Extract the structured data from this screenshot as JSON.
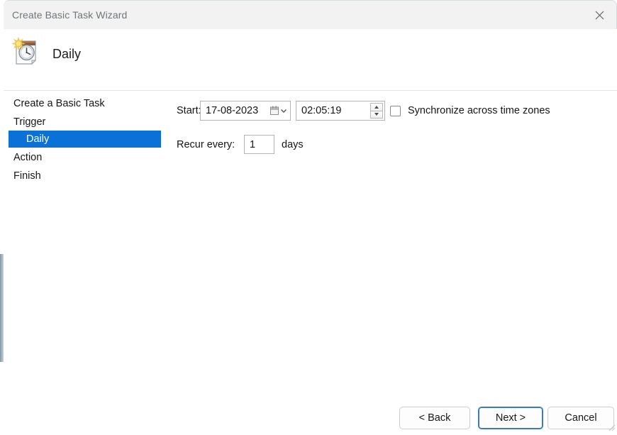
{
  "window": {
    "title": "Create Basic Task Wizard",
    "close_icon": "close-icon"
  },
  "header": {
    "title": "Daily",
    "icon": "daily-task-calendar-clock-icon"
  },
  "sidebar": {
    "items": [
      {
        "label": "Create a Basic Task",
        "selected": false,
        "indent": false
      },
      {
        "label": "Trigger",
        "selected": false,
        "indent": false
      },
      {
        "label": "Daily",
        "selected": true,
        "indent": true
      },
      {
        "label": "Action",
        "selected": false,
        "indent": false
      },
      {
        "label": "Finish",
        "selected": false,
        "indent": false
      }
    ]
  },
  "main": {
    "start_label": "Start:",
    "start_date": "17-08-2023",
    "start_date_icon": "calendar-dropdown-icon",
    "start_time": "02:05:19",
    "spinner_up_icon": "spinner-up-icon",
    "spinner_down_icon": "spinner-down-icon",
    "sync_checkbox_label": "Synchronize across time zones",
    "sync_checkbox_checked": false,
    "recur_label": "Recur every:",
    "recur_value": "1",
    "recur_unit": "days"
  },
  "footer": {
    "back_label": "< Back",
    "next_label": "Next >",
    "cancel_label": "Cancel"
  },
  "colors": {
    "selection_blue": "#0a72d6",
    "default_button_border": "#3a7cb4",
    "titlebar_bg": "#f2f2f2",
    "titlebar_text": "#6f7579"
  }
}
